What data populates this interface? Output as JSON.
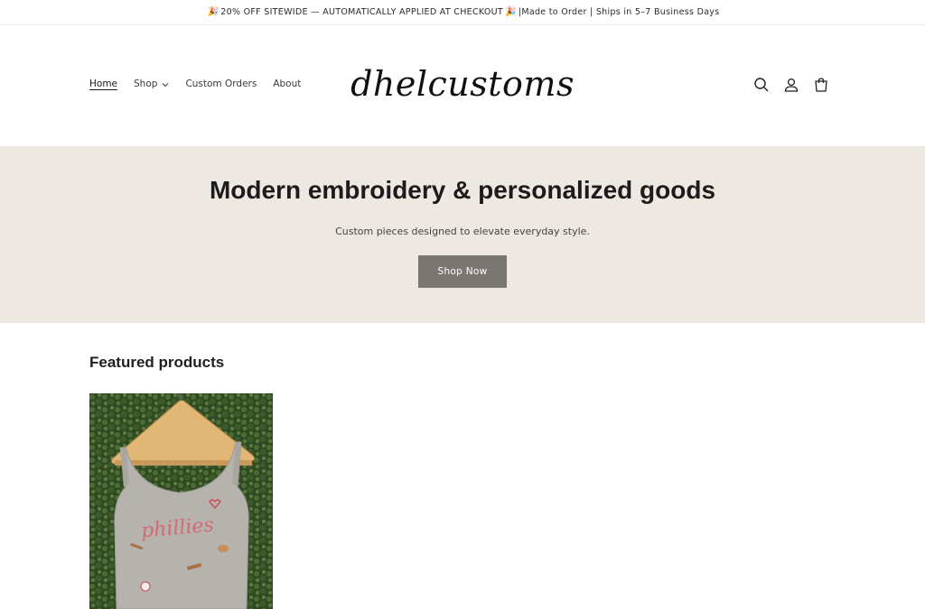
{
  "announcement": {
    "emoji_left": "🎉",
    "text": "20% OFF SITEWIDE — AUTOMATICALLY APPLIED AT CHECKOUT",
    "emoji_right": "🎉",
    "separator": "|",
    "text2": "Made to Order | Ships in 5–7 Business Days"
  },
  "nav": {
    "home": "Home",
    "shop": "Shop",
    "custom_orders": "Custom Orders",
    "about": "About"
  },
  "logo": {
    "text": "dhelcustoms"
  },
  "header_icons": [
    "search-icon",
    "account-icon",
    "cart-icon"
  ],
  "hero": {
    "title": "Modern embroidery & personalized goods",
    "subtitle": "Custom pieces designed to elevate everyday style.",
    "button": "Shop Now",
    "background": "#ede8e2",
    "button_color": "#7a7772"
  },
  "featured": {
    "title": "Featured products",
    "products": [
      {
        "embroidery_text": "phillies"
      }
    ]
  }
}
